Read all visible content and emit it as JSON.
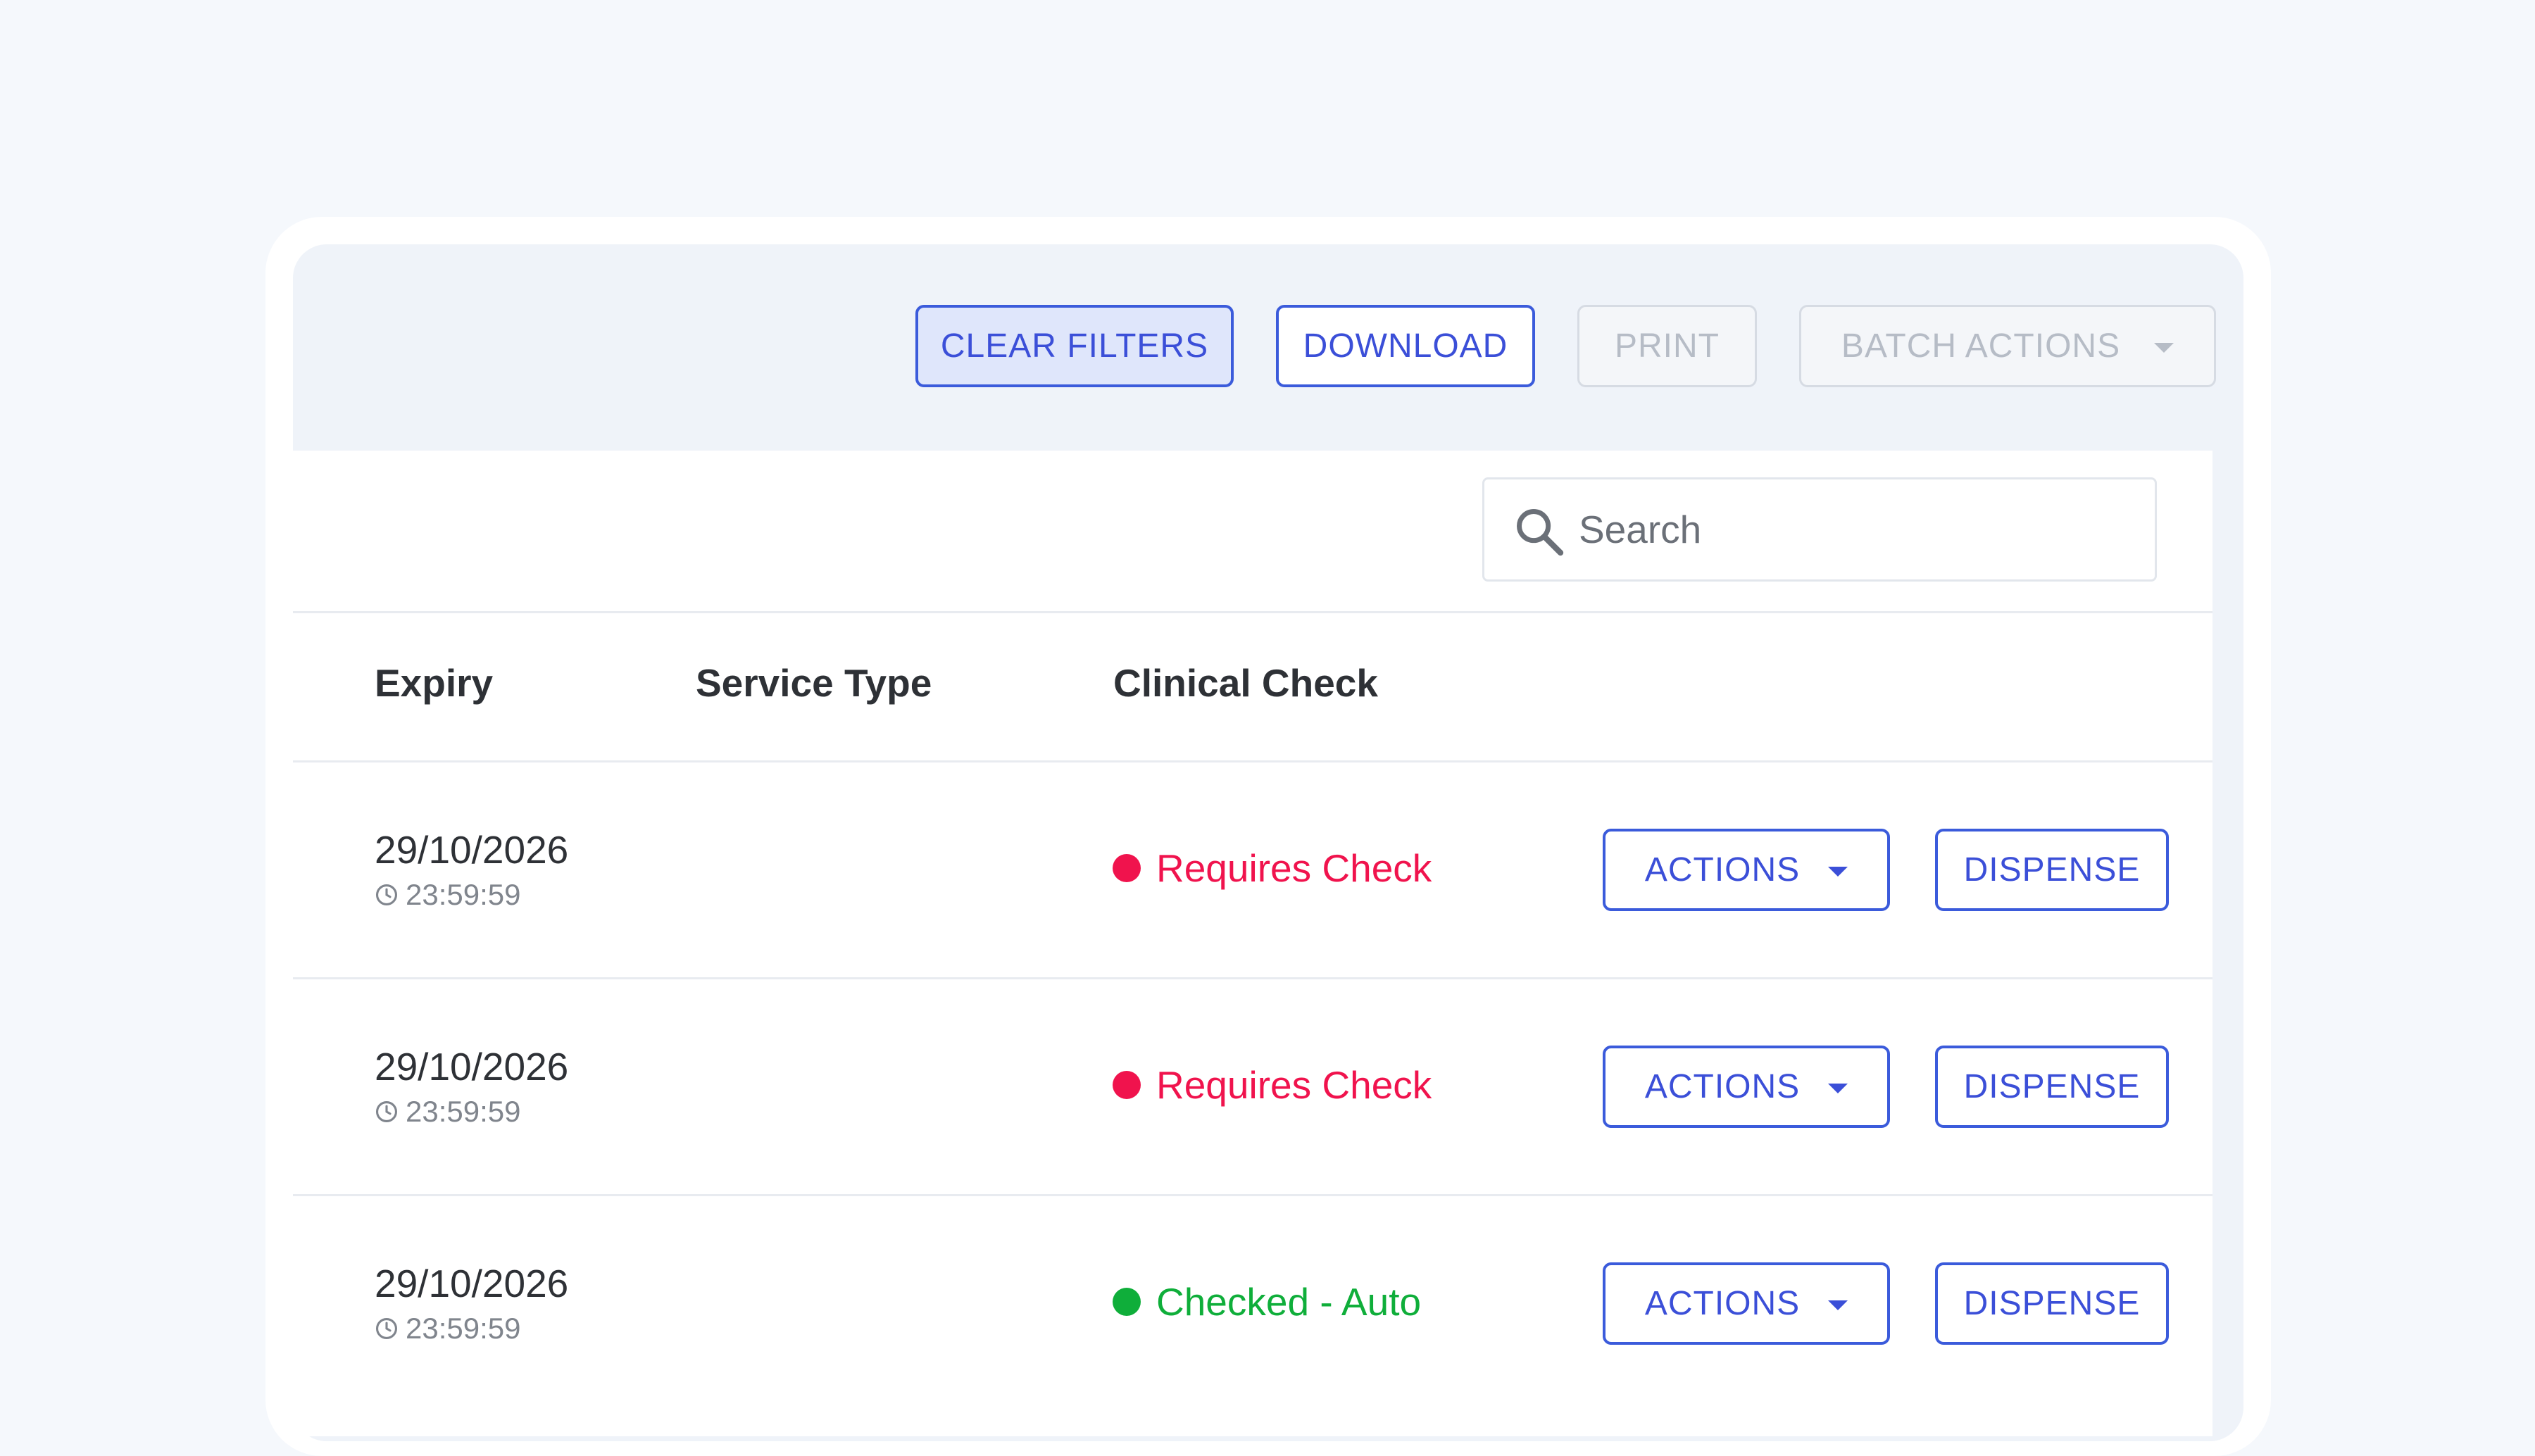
{
  "colors": {
    "page_background": "#f5f8fc",
    "primary": "#3b4fd8",
    "requires_check": "#f0134d",
    "checked_auto": "#0fae3a",
    "disabled_text": "#b6bcc6"
  },
  "toolbar": {
    "clear_filters_label": "CLEAR FILTERS",
    "download_label": "DOWNLOAD",
    "print_label": "PRINT",
    "batch_actions_label": "BATCH ACTIONS"
  },
  "search": {
    "placeholder": "Search",
    "icon": "search-icon"
  },
  "table": {
    "columns": [
      "Expiry",
      "Service Type",
      "Clinical Check"
    ],
    "rows": [
      {
        "expiry_date": "29/10/2026",
        "expiry_time": "23:59:59",
        "service_type": "",
        "clinical_check": "Requires Check",
        "status": "requires",
        "actions_label": "ACTIONS",
        "dispense_label": "DISPENSE"
      },
      {
        "expiry_date": "29/10/2026",
        "expiry_time": "23:59:59",
        "service_type": "",
        "clinical_check": "Requires Check",
        "status": "requires",
        "actions_label": "ACTIONS",
        "dispense_label": "DISPENSE"
      },
      {
        "expiry_date": "29/10/2026",
        "expiry_time": "23:59:59",
        "service_type": "",
        "clinical_check": "Checked - Auto",
        "status": "checked",
        "actions_label": "ACTIONS",
        "dispense_label": "DISPENSE"
      }
    ]
  }
}
